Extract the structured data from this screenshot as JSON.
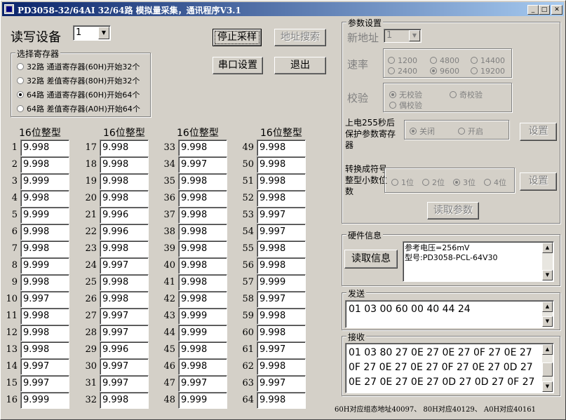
{
  "window": {
    "title": "PD3058-32/64AI  32/64路  模拟量采集，通讯程序V3.1"
  },
  "device": {
    "label": "读写设备",
    "value": "1"
  },
  "buttons": {
    "stop": "停止采样",
    "search": "地址搜索",
    "serial": "串口设置",
    "exit": "退出"
  },
  "register": {
    "caption": "选择寄存器",
    "options": [
      "32路 通道寄存器(60H)开始32个",
      "32路 差值寄存器(80H)开始32个",
      "64路 通道寄存器(60H)开始64个",
      "64路 差值寄存器(A0H)开始64个"
    ],
    "selected": 2
  },
  "channels": {
    "header": "16位整型",
    "values": [
      "9.998",
      "9.998",
      "9.999",
      "9.998",
      "9.999",
      "9.998",
      "9.998",
      "9.999",
      "9.998",
      "9.997",
      "9.998",
      "9.998",
      "9.998",
      "9.997",
      "9.997",
      "9.999",
      "9.998",
      "9.998",
      "9.998",
      "9.998",
      "9.996",
      "9.996",
      "9.998",
      "9.997",
      "9.998",
      "9.998",
      "9.997",
      "9.997",
      "9.996",
      "9.997",
      "9.997",
      "9.998",
      "9.998",
      "9.997",
      "9.998",
      "9.998",
      "9.998",
      "9.998",
      "9.998",
      "9.998",
      "9.998",
      "9.998",
      "9.999",
      "9.999",
      "9.998",
      "9.998",
      "9.997",
      "9.999",
      "9.998",
      "9.998",
      "9.998",
      "9.998",
      "9.997",
      "9.997",
      "9.998",
      "9.998",
      "9.999",
      "9.997",
      "9.998",
      "9.998",
      "9.997",
      "9.998",
      "9.997",
      "9.998"
    ]
  },
  "params": {
    "caption": "参数设置",
    "new_addr_label": "新地址",
    "new_addr_value": "1",
    "rate_label": "速率",
    "rates": [
      "1200",
      "4800",
      "14400",
      "2400",
      "9600",
      "19200"
    ],
    "rate_selected": 4,
    "check_label": "校验",
    "checks": [
      "无校验",
      "奇校验",
      "偶校验"
    ],
    "check_selected": 0,
    "protect_label": "上电255秒后保护参数寄存器",
    "protect_opts": [
      "关闭",
      "开启"
    ],
    "protect_selected": 0,
    "set_label": "设置",
    "decimal_label": "转换成符号整型小数位数",
    "decimals": [
      "1位",
      "2位",
      "3位",
      "4位"
    ],
    "decimal_selected": 2,
    "read_params": "读取参数"
  },
  "hardware": {
    "caption": "硬件信息",
    "button": "读取信息",
    "line1": "参考电压=256mV",
    "line2": "型号:PD3058-PCL-64V30"
  },
  "send": {
    "caption": "发送",
    "text": "01 03 00 60 00 40 44 24"
  },
  "receive": {
    "caption": "接收",
    "line1": "01 03 80 27 0E 27 0E 27 0F 27 0E 27",
    "line2": "0F 27 0E 27 0E 27 0F 27 0E 27 0D 27",
    "line3": "0E 27 0E 27 0E 27 0D 27 0D 27 0F 27"
  },
  "footer": "60H对应组态地址40097、 80H对应40129、 A0H对应40161"
}
